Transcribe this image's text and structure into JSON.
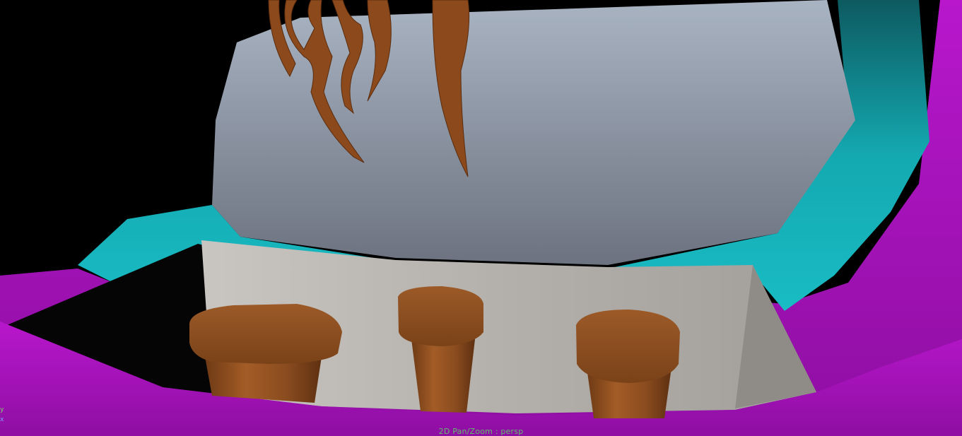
{
  "viewport": {
    "camera": "persp",
    "hud_text": "2D Pan/Zoom : persp",
    "axis_labels": {
      "y": "y",
      "x": "x"
    },
    "colors": {
      "background": "#000000",
      "sky_top": "#a9b4c2",
      "sky_bottom": "#6e7482",
      "cyan_rim": "#18b6bd",
      "magenta_ground": "#b015c4",
      "stone_wall": "#b9b5b1",
      "wood": "#8a4c1f",
      "hud_text": "#5fbf6a"
    }
  }
}
